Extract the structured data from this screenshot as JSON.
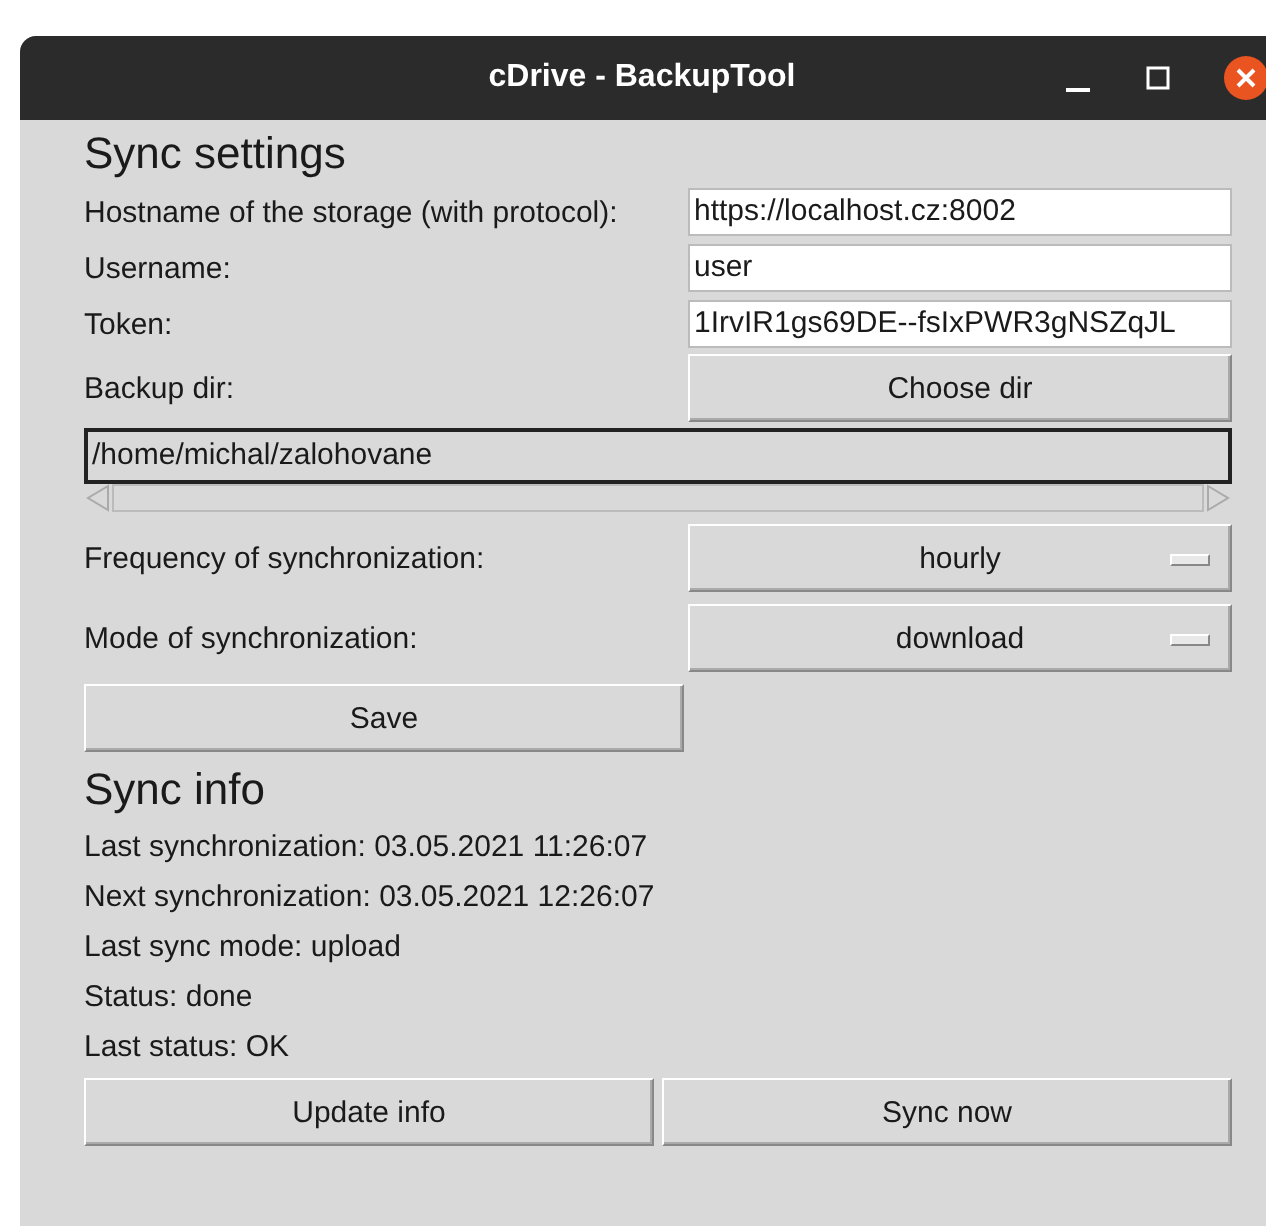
{
  "window": {
    "title": "cDrive - BackupTool"
  },
  "settings": {
    "heading": "Sync settings",
    "fields": [
      {
        "label": "Hostname of the storage (with protocol):",
        "value": "https://localhost.cz:8002"
      },
      {
        "label": "Username:",
        "value": "user"
      },
      {
        "label": "Token:",
        "value": "1IrvIR1gs69DE--fsIxPWR3gNSZqJL"
      }
    ],
    "backup_dir": {
      "label": "Backup dir:",
      "button": "Choose dir",
      "path": "/home/michal/zalohovane"
    },
    "selects": [
      {
        "label": "Frequency of synchronization:",
        "value": "hourly"
      },
      {
        "label": "Mode of synchronization:",
        "value": "download"
      }
    ],
    "save_button": "Save"
  },
  "info": {
    "heading": "Sync info",
    "lines": [
      "Last synchronization: 03.05.2021 11:26:07",
      "Next synchronization: 03.05.2021 12:26:07",
      "Last sync mode: upload",
      "Status: done",
      "Last status: OK"
    ],
    "buttons": [
      "Update info",
      "Sync now"
    ]
  }
}
